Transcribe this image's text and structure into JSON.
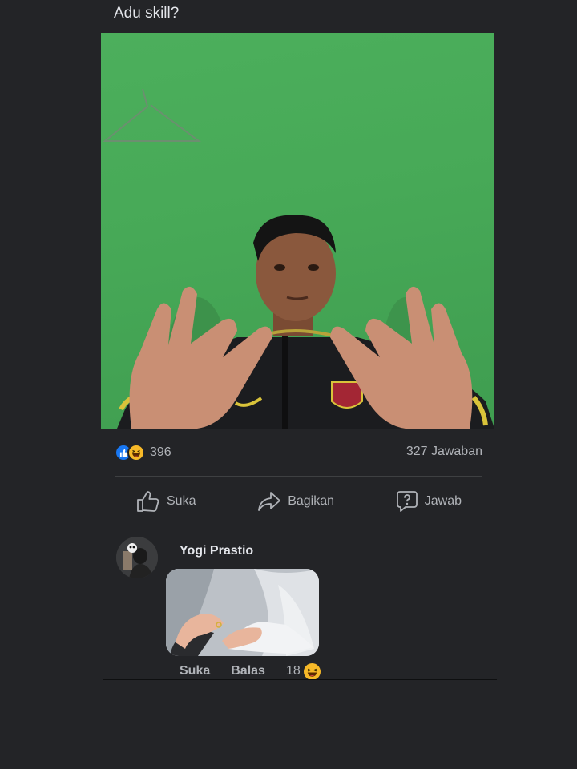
{
  "post": {
    "title": "Adu skill?"
  },
  "stats": {
    "reaction_count": "396",
    "answers": "327 Jawaban",
    "reaction_icons": [
      "like-icon",
      "haha-icon"
    ]
  },
  "actions": {
    "like_label": "Suka",
    "share_label": "Bagikan",
    "answer_label": "Jawab"
  },
  "comment": {
    "author": "Yogi Prastio",
    "like_label": "Suka",
    "reply_label": "Balas",
    "reaction_count": "18",
    "reaction_icon": "haha-icon"
  },
  "colors": {
    "background": "#232427",
    "photo_wall": "#47a957",
    "accent_like": "#1877f2",
    "haha": "#f7b928"
  }
}
